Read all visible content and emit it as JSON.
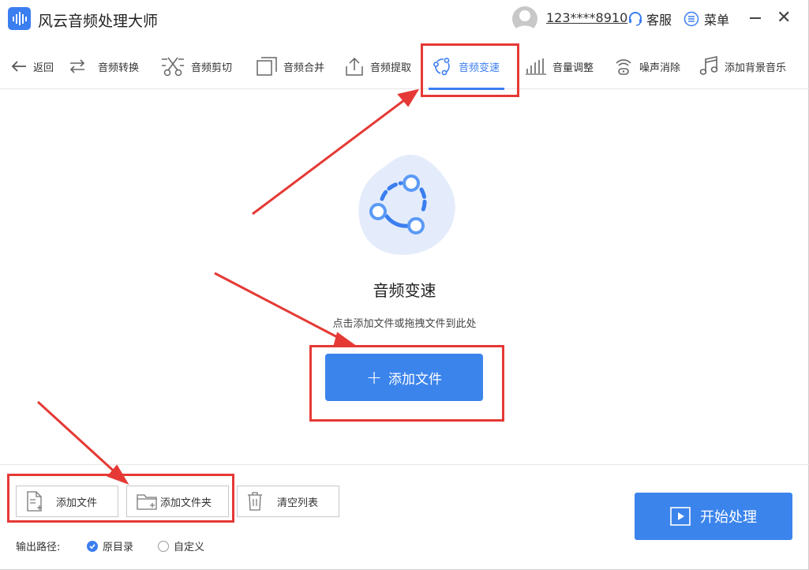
{
  "app": {
    "title": "风云音频处理大师"
  },
  "header": {
    "username": "123****8910",
    "service_label": "客服",
    "menu_label": "菜单"
  },
  "toolbar": {
    "back_label": "返回",
    "items": [
      {
        "label": "音频转换",
        "icon": "convert-icon"
      },
      {
        "label": "音频剪切",
        "icon": "scissors-icon"
      },
      {
        "label": "音频合并",
        "icon": "merge-icon"
      },
      {
        "label": "音频提取",
        "icon": "extract-icon"
      },
      {
        "label": "音频变速",
        "icon": "speed-icon",
        "active": true
      },
      {
        "label": "音量调整",
        "icon": "volume-icon"
      },
      {
        "label": "噪声消除",
        "icon": "noise-icon"
      },
      {
        "label": "添加背景音乐",
        "icon": "music-note-icon"
      }
    ]
  },
  "main": {
    "title": "音频变速",
    "hint": "点击添加文件或拖拽文件到此处",
    "add_button_label": "添加文件"
  },
  "bottom": {
    "add_file_label": "添加文件",
    "add_folder_label": "添加文件夹",
    "clear_list_label": "清空列表",
    "output_path_label": "输出路径:",
    "options": [
      {
        "label": "原目录",
        "checked": true
      },
      {
        "label": "自定义",
        "checked": false
      }
    ],
    "start_label": "开始处理"
  },
  "colors": {
    "accent": "#3b7ef0",
    "highlight": "#e53935"
  }
}
